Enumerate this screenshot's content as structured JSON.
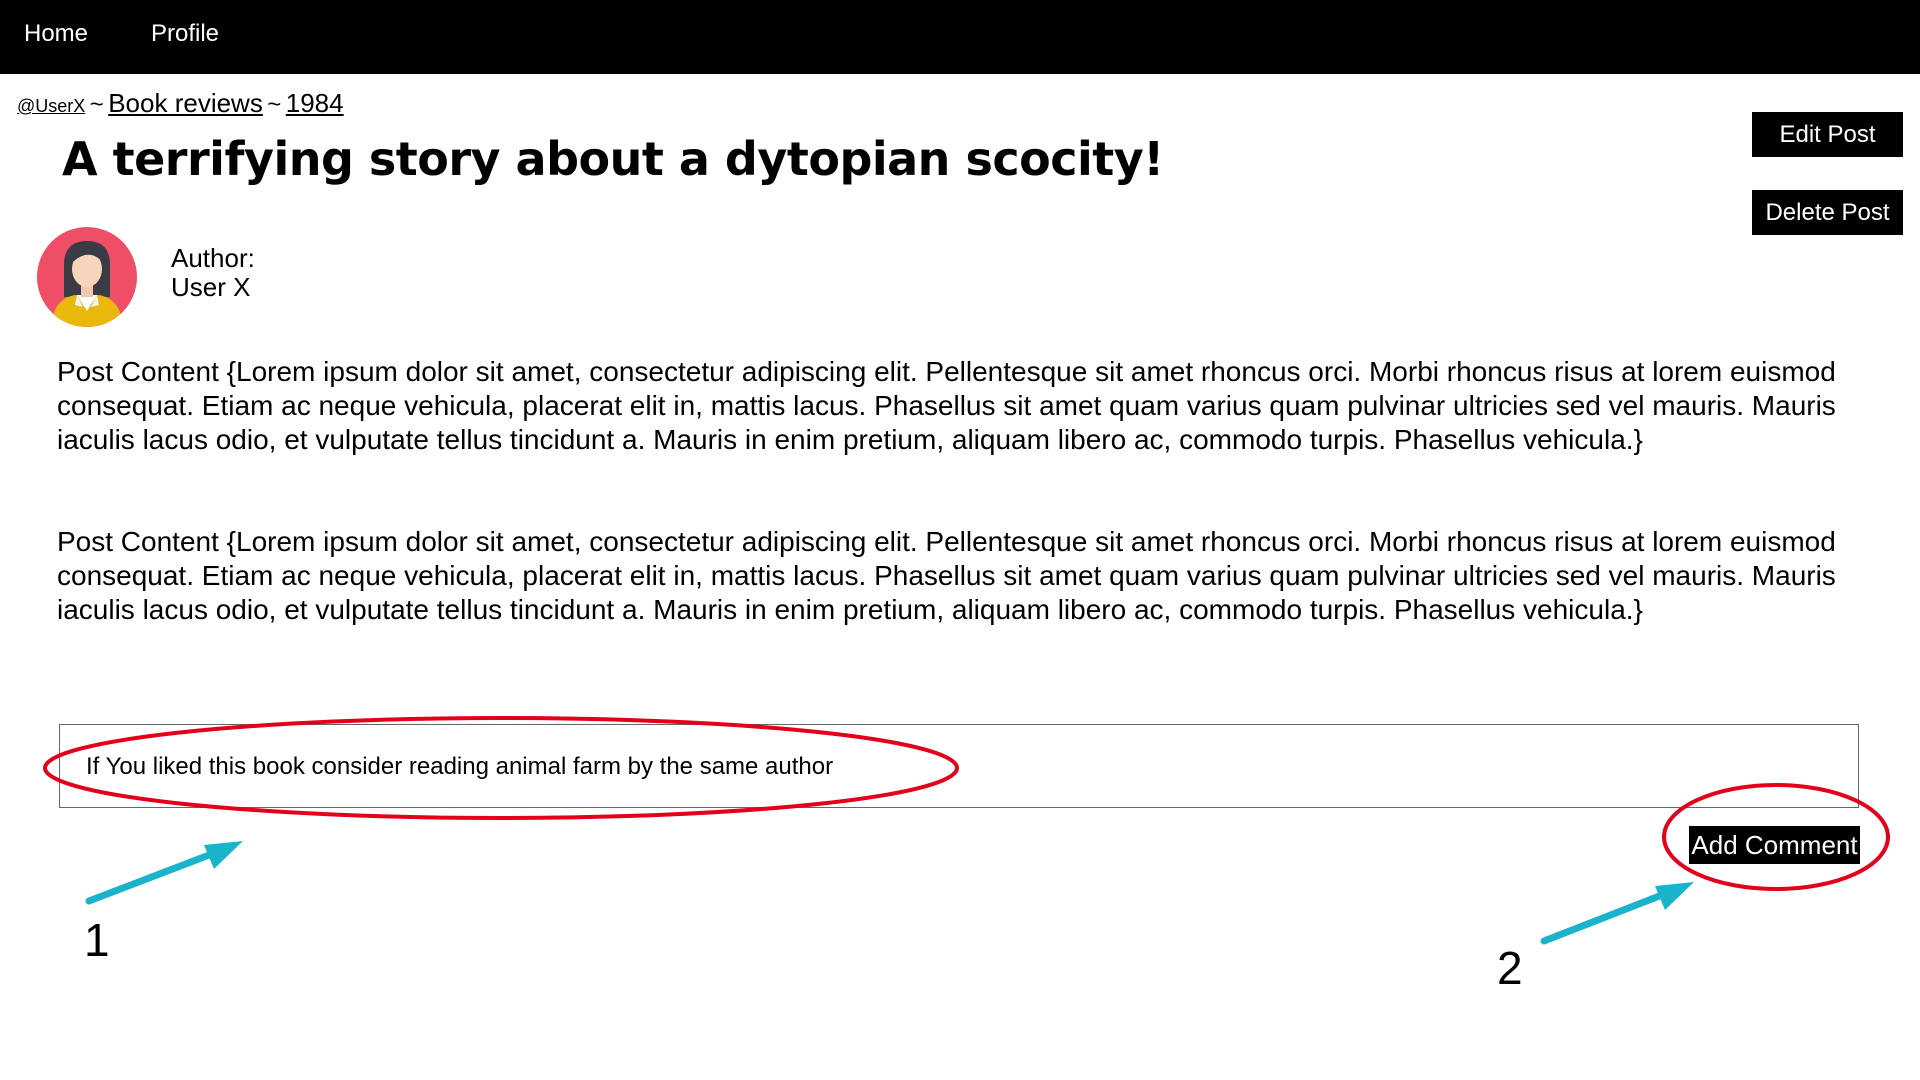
{
  "nav": {
    "home_label": "Home",
    "profile_label": "Profile"
  },
  "breadcrumb": {
    "user": "@UserX",
    "separator": "~",
    "category": "Book reviews",
    "book": "1984"
  },
  "post": {
    "title": "A terrifying story about a dytopian scocity!",
    "author_label": "Author:",
    "author_name": "User X",
    "paragraphs": [
      "Post Content  {Lorem ipsum dolor sit amet, consectetur adipiscing elit. Pellentesque sit amet rhoncus orci. Morbi rhoncus risus at lorem euismod consequat. Etiam ac neque vehicula, placerat elit in, mattis lacus. Phasellus sit amet quam varius quam pulvinar ultricies sed vel mauris. Mauris iaculis lacus odio, et vulputate tellus tincidunt a. Mauris in enim pretium, aliquam libero ac, commodo turpis. Phasellus vehicula.}",
      "Post Content  {Lorem ipsum dolor sit amet, consectetur adipiscing elit. Pellentesque sit amet rhoncus orci. Morbi rhoncus risus at lorem euismod consequat. Etiam ac neque vehicula, placerat elit in, mattis lacus. Phasellus sit amet quam varius quam pulvinar ultricies sed vel mauris. Mauris iaculis lacus odio, et vulputate tellus tincidunt a. Mauris in enim pretium, aliquam libero ac, commodo turpis. Phasellus vehicula.}"
    ]
  },
  "actions": {
    "edit_label": "Edit Post",
    "delete_label": "Delete Post"
  },
  "comment": {
    "value": "If You liked this book consider reading animal farm by the same author",
    "add_label": "Add Comment"
  },
  "annotations": {
    "label_1": "1",
    "label_2": "2"
  },
  "icons": {
    "avatar": "user-avatar-icon"
  },
  "colors": {
    "nav_bg": "#000000",
    "button_bg": "#000000",
    "annotation_circle": "#e3001b",
    "annotation_arrow": "#1ab3cc",
    "avatar_bg": "#ef4f66",
    "avatar_shirt": "#e8b80c"
  }
}
